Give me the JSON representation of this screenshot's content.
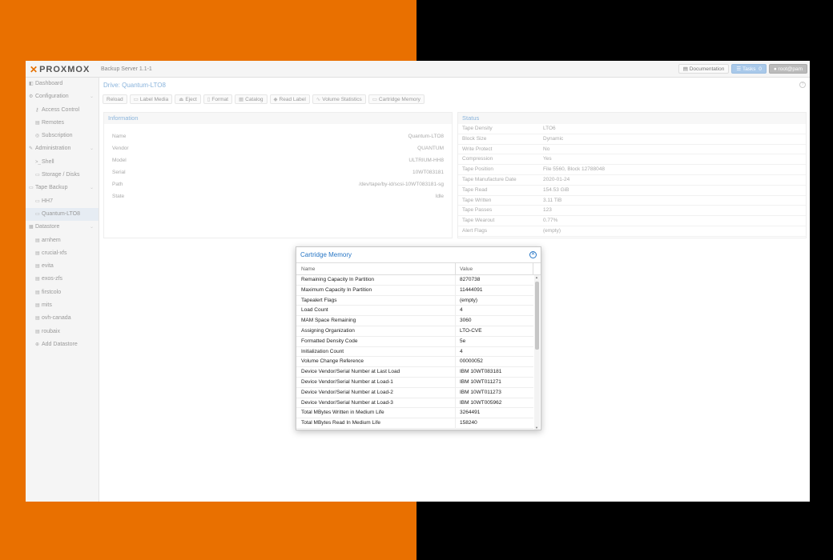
{
  "app": {
    "logo_text": "PROXMOX",
    "product": "Backup Server 1.1-1",
    "documentation_label": "Documentation",
    "tasks_label": "Tasks",
    "tasks_count": "0",
    "user_label": "root@pam"
  },
  "sidebar": {
    "items": [
      {
        "label": "Dashboard",
        "icon": "dashboard-icon",
        "sub": false,
        "chev": ""
      },
      {
        "label": "Configuration",
        "icon": "gears-icon",
        "sub": false,
        "chev": "⌄"
      },
      {
        "label": "Access Control",
        "icon": "key-icon",
        "sub": true,
        "chev": ""
      },
      {
        "label": "Remotes",
        "icon": "server-icon",
        "sub": true,
        "chev": ""
      },
      {
        "label": "Subscription",
        "icon": "support-icon",
        "sub": true,
        "chev": ""
      },
      {
        "label": "Administration",
        "icon": "wrench-icon",
        "sub": false,
        "chev": "⌄"
      },
      {
        "label": "Shell",
        "icon": "terminal-icon",
        "sub": true,
        "chev": ""
      },
      {
        "label": "Storage / Disks",
        "icon": "hdd-icon",
        "sub": true,
        "chev": ""
      },
      {
        "label": "Tape Backup",
        "icon": "tape-icon",
        "sub": false,
        "chev": "⌄"
      },
      {
        "label": "HH7",
        "icon": "drive-icon",
        "sub": true,
        "chev": ""
      },
      {
        "label": "Quantum-LTO8",
        "icon": "drive-icon",
        "sub": true,
        "chev": "",
        "active": true
      },
      {
        "label": "Datastore",
        "icon": "archive-icon",
        "sub": false,
        "chev": "⌄"
      },
      {
        "label": "arnhem",
        "icon": "database-icon",
        "sub": true,
        "chev": ""
      },
      {
        "label": "crucial-xfs",
        "icon": "database-icon",
        "sub": true,
        "chev": ""
      },
      {
        "label": "evita",
        "icon": "database-icon",
        "sub": true,
        "chev": ""
      },
      {
        "label": "exos-zfs",
        "icon": "database-icon",
        "sub": true,
        "chev": ""
      },
      {
        "label": "firstcolo",
        "icon": "database-icon",
        "sub": true,
        "chev": ""
      },
      {
        "label": "mits",
        "icon": "database-icon",
        "sub": true,
        "chev": ""
      },
      {
        "label": "ovh-canada",
        "icon": "database-icon",
        "sub": true,
        "chev": ""
      },
      {
        "label": "roubaix",
        "icon": "database-icon",
        "sub": true,
        "chev": ""
      },
      {
        "label": "Add Datastore",
        "icon": "plus-circle-icon",
        "sub": true,
        "chev": ""
      }
    ]
  },
  "main": {
    "drive_title": "Drive: Quantum-LTO8",
    "toolbar": [
      {
        "label": "Reload",
        "icon": "",
        "name": "reload-button"
      },
      {
        "label": "Label Media",
        "icon": "▭",
        "name": "label-media-button"
      },
      {
        "label": "Eject",
        "icon": "⏏",
        "name": "eject-button"
      },
      {
        "label": "Format",
        "icon": "▯",
        "name": "format-button"
      },
      {
        "label": "Catalog",
        "icon": "▦",
        "name": "catalog-button"
      },
      {
        "label": "Read Label",
        "icon": "◆",
        "name": "read-label-button"
      },
      {
        "label": "Volume Statistics",
        "icon": "∿",
        "name": "volume-statistics-button"
      },
      {
        "label": "Cartridge Memory",
        "icon": "▭",
        "name": "cartridge-memory-button"
      }
    ],
    "information": {
      "header": "Information",
      "rows": [
        {
          "key": "Name",
          "value": "Quantum-LTO8"
        },
        {
          "key": "Vendor",
          "value": "QUANTUM"
        },
        {
          "key": "Model",
          "value": "ULTRIUM-HH8"
        },
        {
          "key": "Serial",
          "value": "10WT083181"
        },
        {
          "key": "Path",
          "value": "/dev/tape/by-id/scsi-10WT083181-sg"
        },
        {
          "key": "State",
          "value": "Idle"
        }
      ]
    },
    "status": {
      "header": "Status",
      "rows": [
        {
          "key": "Tape Density",
          "value": "LTO6"
        },
        {
          "key": "Block Size",
          "value": "Dynamic"
        },
        {
          "key": "Write Protect",
          "value": "No"
        },
        {
          "key": "Compression",
          "value": "Yes"
        },
        {
          "key": "Tape Position",
          "value": "File 5560, Block 12788048"
        },
        {
          "key": "Tape Manufacture Date",
          "value": "2020-01-24"
        },
        {
          "key": "Tape Read",
          "value": "154.53 GiB"
        },
        {
          "key": "Tape Written",
          "value": "3.11 TiB"
        },
        {
          "key": "Tape Passes",
          "value": "123"
        },
        {
          "key": "Tape Wearout",
          "value": "0.77%"
        },
        {
          "key": "Alert Flags",
          "value": "(empty)"
        }
      ]
    }
  },
  "modal": {
    "title": "Cartridge Memory",
    "col_name": "Name",
    "col_value": "Value",
    "rows": [
      {
        "name": "Remaining Capacity In Partition",
        "value": "8270738"
      },
      {
        "name": "Maximum Capacity In Partition",
        "value": "11444091"
      },
      {
        "name": "Tapealert Flags",
        "value": "(empty)"
      },
      {
        "name": "Load Count",
        "value": "4"
      },
      {
        "name": "MAM Space Remaining",
        "value": "3060"
      },
      {
        "name": "Assigning Organization",
        "value": "LTO-CVE"
      },
      {
        "name": "Formatted Density Code",
        "value": "5e"
      },
      {
        "name": "Initialization Count",
        "value": "4"
      },
      {
        "name": "Volume Change Reference",
        "value": "00000052"
      },
      {
        "name": "Device Vendor/Serial Number at Last Load",
        "value": "IBM 10WT083181"
      },
      {
        "name": "Device Vendor/Serial Number at Load-1",
        "value": "IBM 10WT011271"
      },
      {
        "name": "Device Vendor/Serial Number at Load-2",
        "value": "IBM 10WT011273"
      },
      {
        "name": "Device Vendor/Serial Number at Load-3",
        "value": "IBM 10WT005962"
      },
      {
        "name": "Total MBytes Written in Medium Life",
        "value": "3264491"
      },
      {
        "name": "Total MBytes Read In Medium Life",
        "value": "158240"
      }
    ]
  }
}
